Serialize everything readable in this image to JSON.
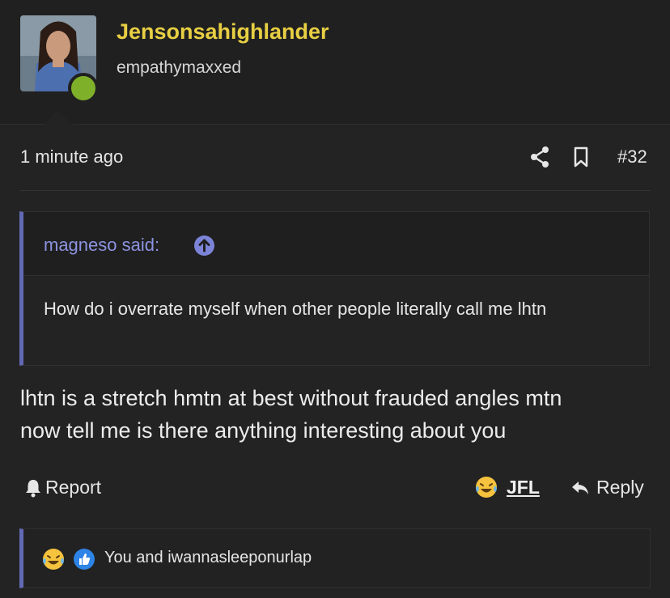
{
  "user": {
    "name": "Jensonsahighlander",
    "title": "empathymaxxed",
    "online": true
  },
  "post": {
    "timestamp": "1 minute ago",
    "number": "#32",
    "body_line1": "lhtn is a stretch hmtn at best without frauded angles mtn",
    "body_line2": "now tell me is there anything interesting about you"
  },
  "quote": {
    "author": "magneso said:",
    "text": "How do i overrate myself when other people literally call me lhtn"
  },
  "actions": {
    "report": "Report",
    "reaction": "JFL",
    "reply": "Reply"
  },
  "reactions": {
    "summary": "You and iwannasleeponurlap",
    "icons": [
      "laughing-crying-emoji",
      "thumbs-up"
    ]
  },
  "colors": {
    "username": "#e8cf43",
    "quote_accent": "#6269b4",
    "quote_author": "#8c93e0",
    "online": "#7fb02a"
  }
}
